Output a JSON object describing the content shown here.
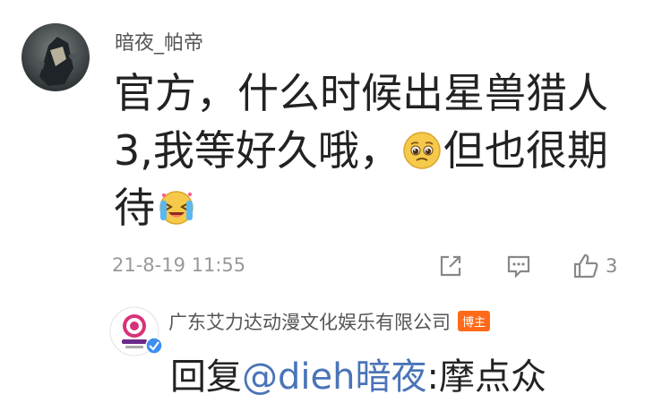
{
  "comment": {
    "username": "暗夜_帕帝",
    "text_part1": "官方，什么时候出星兽猎人3,我等好久哦，",
    "text_part2": "但也很期待",
    "emoji1": "pleading-face",
    "emoji2": "crying-laughing-face",
    "timestamp": "21-8-19 11:55",
    "like_count": "3"
  },
  "reply": {
    "author": "广东艾力达动漫文化娱乐有限公司",
    "badge": "博主",
    "prefix": "回复",
    "mention": "@dieh暗夜",
    "text": ":摩点众"
  },
  "colors": {
    "mention": "#4a74b8",
    "badge": "#ff6a1a"
  }
}
